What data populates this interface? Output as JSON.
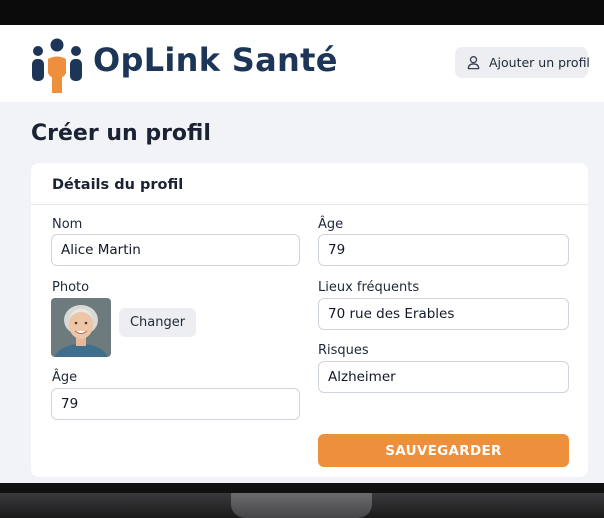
{
  "app": {
    "brand": "OpLink Santé",
    "header_button": "Ajouter un profil"
  },
  "page": {
    "title": "Créer un profil"
  },
  "card": {
    "title": "Détails du profil",
    "left": {
      "nom_label": "Nom",
      "nom_value": "Alice Martin",
      "photo_label": "Photo",
      "change_button": "Changer",
      "age_label": "Âge",
      "age_value": "79"
    },
    "right": {
      "age_label": "Âge",
      "age_value": "79",
      "lieux_label": "Lieux fréquents",
      "lieux_value": "70 rue des Erables",
      "risques_label": "Risques",
      "risques_value": "Alzheimer"
    },
    "save_button": "SAUVEGARDER"
  },
  "colors": {
    "brand": "#1d3557",
    "accent": "#ed8f3b",
    "background": "#f1f3f6"
  },
  "icons": {
    "logo": "people-group-icon",
    "header_button": "user-icon"
  }
}
